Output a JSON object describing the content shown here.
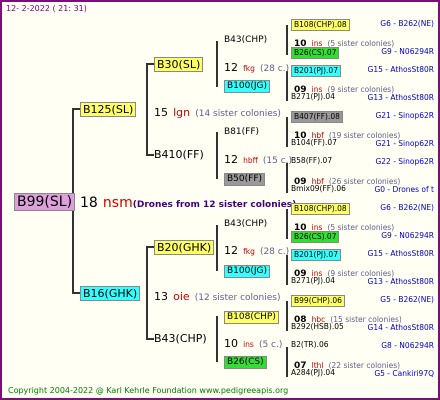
{
  "header": {
    "date": "12- 2-2022 ( 21: 31)"
  },
  "footer": {
    "text": "Copyright 2004-2022 @ Karl Kehrle Foundation     www.pedigreeapis.org"
  },
  "gen1": {
    "name": "B99(SL)",
    "num": "18",
    "code": "nsm",
    "note": "(Drones from 12 sister colonies)"
  },
  "gen2": [
    {
      "name": "B125(SL)",
      "num": "15",
      "code": "lgn",
      "note": "(14 sister colonies)"
    },
    {
      "name": "B16(GHK)",
      "num": "13",
      "code": "oie",
      "note": "(12 sister colonies)"
    }
  ],
  "gen3": [
    {
      "name": "B30(SL)",
      "num": "12",
      "code": "fkg",
      "note": "(28 c.)"
    },
    {
      "name": "B410(FF)",
      "num": "12",
      "code": "hbff",
      "note": "(15 c.)"
    },
    {
      "name": "B20(GHK)",
      "num": "12",
      "code": "fkg",
      "note": "(28 c.)"
    },
    {
      "name": "B43(CHP)",
      "num": "10",
      "code": "ins",
      "note": "(5 c.)"
    }
  ],
  "gen4": [
    {
      "name": "B43(CHP)"
    },
    {
      "name": "B100(JG)"
    },
    {
      "name": "B81(FF)"
    },
    {
      "name": "B50(FF)"
    },
    {
      "name": "B43(CHP)"
    },
    {
      "name": "B100(JG)"
    },
    {
      "name": "B108(CHP)"
    },
    {
      "name": "B26(CS)"
    }
  ],
  "gen5": [
    {
      "name": "B108(CHP).08",
      "right": "G6 - B262(NE)",
      "num": "10",
      "code": "ins",
      "note": "(5 sister colonies)"
    },
    {
      "name": "B26(CS).07",
      "right": "G9 - N06294R"
    },
    {
      "name": "B201(PJ).07",
      "right": "G15 - AthosSt80R",
      "num": "09",
      "code": "ins",
      "note": "(9 sister colonies)"
    },
    {
      "name": "B271(PJ).04",
      "right": "G13 - AthosSt80R"
    },
    {
      "name": "B407(FF).08",
      "right": "G21 - Sinop62R",
      "num": "10",
      "code": "hbf",
      "note": "(19 sister colonies)"
    },
    {
      "name": "B104(FF).07",
      "right": "G21 - Sinop62R"
    },
    {
      "name": "B58(FF).07",
      "right": "G22 - Sinop62R",
      "num": "09",
      "code": "hbf",
      "note": "(26 sister colonies)"
    },
    {
      "name": "Bmix09(FF).06",
      "right": "G0 - Drones of t"
    },
    {
      "name": "B108(CHP).08",
      "right": "G6 - B262(NE)",
      "num": "10",
      "code": "ins",
      "note": "(5 sister colonies)"
    },
    {
      "name": "B26(CS).07",
      "right": "G9 - N06294R"
    },
    {
      "name": "B201(PJ).07",
      "right": "G15 - AthosSt80R",
      "num": "09",
      "code": "ins",
      "note": "(9 sister colonies)"
    },
    {
      "name": "B271(PJ).04",
      "right": "G13 - AthosSt80R"
    },
    {
      "name": "B99(CHP).06",
      "right": "G5 - B262(NE)",
      "num": "08",
      "code": "hbc",
      "note": "(15 sister colonies)"
    },
    {
      "name": "B292(HSB).05",
      "right": "G14 - AthosSt80R"
    },
    {
      "name": "B2(TR).06",
      "right": "G8 - N06294R",
      "num": "07",
      "code": "lthl",
      "note": "(22 sister colonies)"
    },
    {
      "name": "A284(PJ).04",
      "right": "G5 - Cankiri97Q"
    }
  ]
}
